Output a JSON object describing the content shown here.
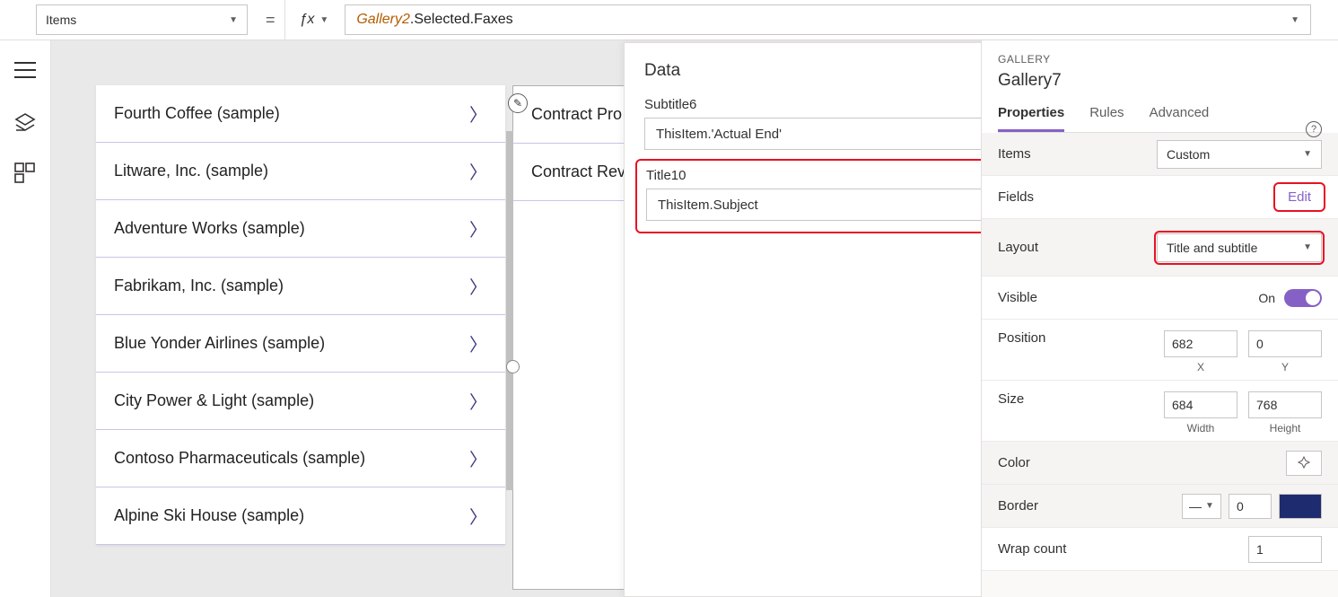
{
  "formula_bar": {
    "property": "Items",
    "expr_obj": "Gallery2",
    "expr_rest": ".Selected.Faxes"
  },
  "gallery1": {
    "items": [
      "Fourth Coffee (sample)",
      "Litware, Inc. (sample)",
      "Adventure Works (sample)",
      "Fabrikam, Inc. (sample)",
      "Blue Yonder Airlines (sample)",
      "City Power & Light (sample)",
      "Contoso Pharmaceuticals (sample)",
      "Alpine Ski House (sample)"
    ]
  },
  "gallery2": {
    "items": [
      "Contract Pro",
      "Contract Rev"
    ]
  },
  "data_pane": {
    "title": "Data",
    "subtitle_label": "Subtitle6",
    "subtitle_value": "ThisItem.'Actual End'",
    "title_label": "Title10",
    "title_value": "ThisItem.Subject"
  },
  "props": {
    "type": "GALLERY",
    "name": "Gallery7",
    "tabs": [
      "Properties",
      "Rules",
      "Advanced"
    ],
    "items_label": "Items",
    "items_value": "Custom",
    "fields_label": "Fields",
    "fields_action": "Edit",
    "layout_label": "Layout",
    "layout_value": "Title and subtitle",
    "visible_label": "Visible",
    "visible_value": "On",
    "position_label": "Position",
    "pos_x": "682",
    "pos_y": "0",
    "pos_x_lbl": "X",
    "pos_y_lbl": "Y",
    "size_label": "Size",
    "size_w": "684",
    "size_h": "768",
    "size_w_lbl": "Width",
    "size_h_lbl": "Height",
    "color_label": "Color",
    "border_label": "Border",
    "border_value": "0",
    "wrap_label": "Wrap count",
    "wrap_value": "1"
  }
}
